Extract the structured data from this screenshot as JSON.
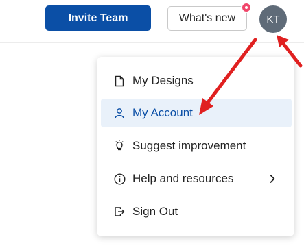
{
  "header": {
    "invite_button": "Invite Team",
    "whats_new_button": "What's new",
    "avatar_initials": "KT"
  },
  "menu": {
    "items": [
      {
        "label": "My Designs",
        "icon": "document-icon"
      },
      {
        "label": "My Account",
        "icon": "person-icon",
        "active": true
      },
      {
        "label": "Suggest improvement",
        "icon": "lightbulb-icon"
      },
      {
        "label": "Help and resources",
        "icon": "info-icon",
        "has_submenu": true
      },
      {
        "label": "Sign Out",
        "icon": "sign-out-icon"
      }
    ]
  },
  "colors": {
    "primary": "#0b4fa6",
    "avatar_bg": "#5f6b78",
    "notification_dot": "#f0466a",
    "active_item_bg": "#e9f1fa",
    "annotation_arrow": "#e02020"
  }
}
